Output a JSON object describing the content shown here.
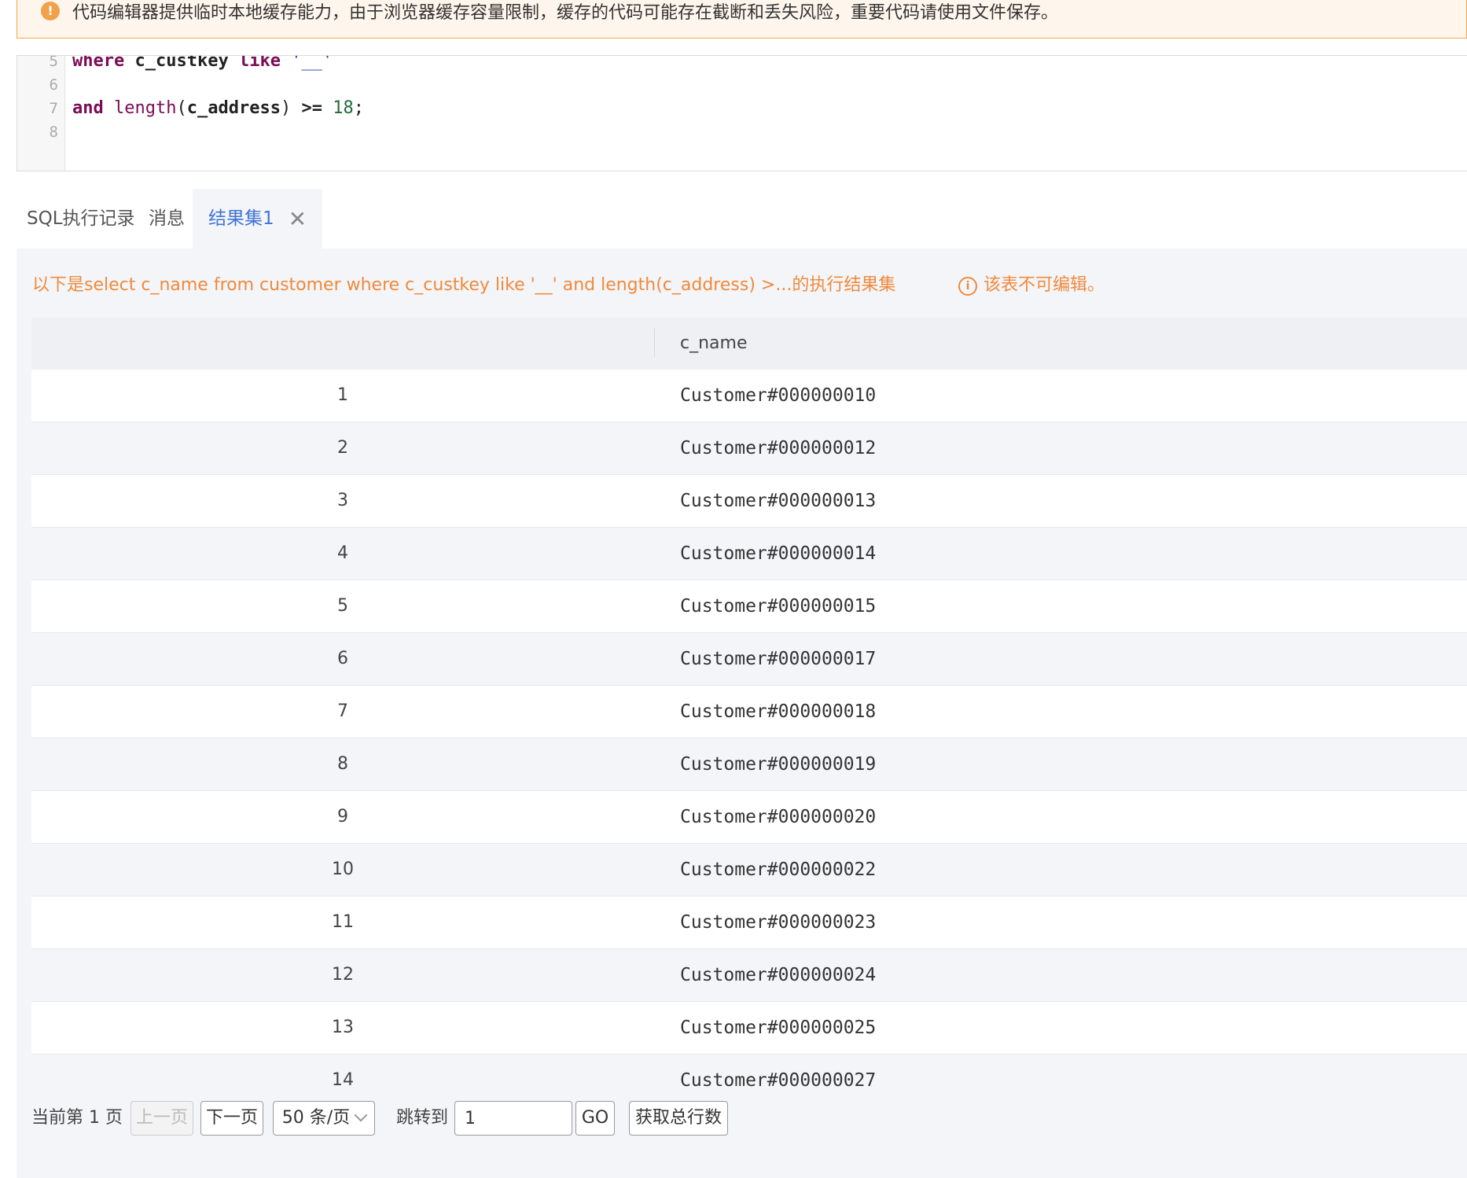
{
  "banner": {
    "icon": "!",
    "text": "代码编辑器提供临时本地缓存能力，由于浏览器缓存容量限制，缓存的代码可能存在截断和丢失风险，重要代码请使用文件保存。"
  },
  "editor": {
    "line_numbers": [
      "5",
      "6",
      "7",
      "8"
    ],
    "line5": {
      "kw1": "where",
      "id1": "c_custkey",
      "kw2": "like",
      "str": "'__'"
    },
    "line7": {
      "kw1": "and",
      "fn": "length",
      "open": "(",
      "id1": "c_address",
      "close": ")",
      "op": ">=",
      "num": "18",
      "end": ";"
    }
  },
  "tabs": {
    "history": "SQL执行记录",
    "messages": "消息",
    "result": "结果集1",
    "close_glyph": "✕"
  },
  "result": {
    "caption": "以下是select c_name from customer where c_custkey like '__' and length(c_address) >...的执行结果集",
    "readonly_icon": "i",
    "readonly_notice": "该表不可编辑。",
    "column": "c_name",
    "rows": [
      {
        "idx": "1",
        "name": "Customer#000000010"
      },
      {
        "idx": "2",
        "name": "Customer#000000012"
      },
      {
        "idx": "3",
        "name": "Customer#000000013"
      },
      {
        "idx": "4",
        "name": "Customer#000000014"
      },
      {
        "idx": "5",
        "name": "Customer#000000015"
      },
      {
        "idx": "6",
        "name": "Customer#000000017"
      },
      {
        "idx": "7",
        "name": "Customer#000000018"
      },
      {
        "idx": "8",
        "name": "Customer#000000019"
      },
      {
        "idx": "9",
        "name": "Customer#000000020"
      },
      {
        "idx": "10",
        "name": "Customer#000000022"
      },
      {
        "idx": "11",
        "name": "Customer#000000023"
      },
      {
        "idx": "12",
        "name": "Customer#000000024"
      },
      {
        "idx": "13",
        "name": "Customer#000000025"
      },
      {
        "idx": "14",
        "name": "Customer#000000027"
      }
    ]
  },
  "pager": {
    "current": "当前第 1 页",
    "prev": "上一页",
    "next": "下一页",
    "page_size": "50 条/页",
    "jump_label": "跳转到",
    "jump_value": "1",
    "go": "GO",
    "count": "获取总行数"
  }
}
